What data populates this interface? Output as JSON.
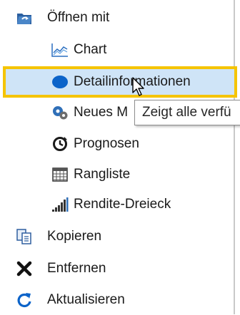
{
  "menu": {
    "open_with": {
      "label": "Öffnen mit",
      "icon": "open-with-icon"
    },
    "submenu": [
      {
        "label": "Chart",
        "icon": "line-chart-icon"
      },
      {
        "label": "Detailinformationen",
        "icon": "blue-oval-icon"
      },
      {
        "label": "Neues M",
        "icon": "gears-icon"
      },
      {
        "label": "Prognosen",
        "icon": "forecast-icon"
      },
      {
        "label": "Rangliste",
        "icon": "ranking-grid-icon"
      },
      {
        "label": "Rendite-Dreieck",
        "icon": "bar-triangle-icon"
      }
    ],
    "actions": [
      {
        "label": "Kopieren",
        "icon": "copy-icon"
      },
      {
        "label": "Entfernen",
        "icon": "remove-x-icon"
      },
      {
        "label": "Aktualisieren",
        "icon": "refresh-icon"
      }
    ]
  },
  "tooltip": {
    "text": "Zeigt alle verfü"
  },
  "colors": {
    "highlight_fill": "#cfe4f7",
    "highlight_border": "#f5c400",
    "icon_blue": "#0b63c9",
    "text": "#1a1a1a"
  }
}
